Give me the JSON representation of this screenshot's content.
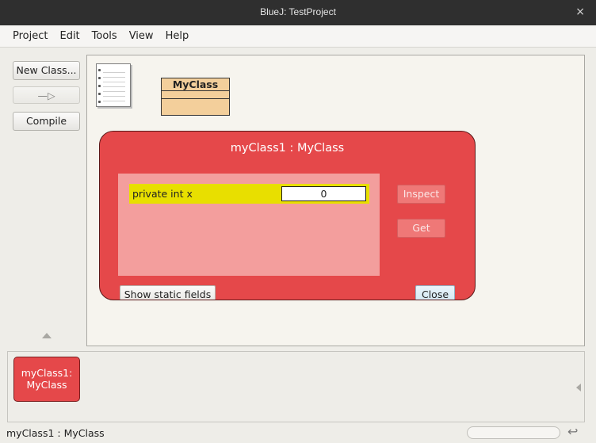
{
  "window": {
    "title": "BlueJ: TestProject",
    "close_glyph": "×"
  },
  "menubar": {
    "items": [
      "Project",
      "Edit",
      "Tools",
      "View",
      "Help"
    ]
  },
  "toolbar": {
    "new_class_label": "New Class...",
    "arrow_glyph": "—▷",
    "compile_label": "Compile"
  },
  "diagram": {
    "class_name": "MyClass",
    "readme_icon": "document-icon"
  },
  "inspector": {
    "title": "myClass1 : MyClass",
    "fields": [
      {
        "name": "private int x",
        "value": "0"
      }
    ],
    "inspect_label": "Inspect",
    "get_label": "Get",
    "show_static_label": "Show static fields",
    "close_label": "Close"
  },
  "object_bench": {
    "items": [
      {
        "line1": "myClass1:",
        "line2": "MyClass"
      }
    ]
  },
  "status": {
    "text": "myClass1 : MyClass",
    "return_glyph": "↩"
  },
  "colors": {
    "object_red": "#e5484a",
    "field_highlight": "#e8df00",
    "class_fill": "#f3cf9b"
  }
}
